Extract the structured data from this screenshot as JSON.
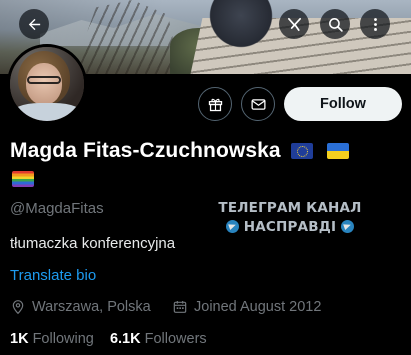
{
  "header": {
    "back_icon": "arrow-left-icon",
    "grok_icon": "grok-icon",
    "search_icon": "search-icon",
    "more_icon": "more-vertical-icon"
  },
  "profile": {
    "display_name": "Magda Fitas-Czuchnowska",
    "flags": [
      "eu-flag",
      "ukraine-flag",
      "rainbow-flag"
    ],
    "handle": "@MagdaFitas",
    "bio": "tłumaczka konferencyjna",
    "translate_label": "Translate bio",
    "location": "Warszawa, Polska",
    "joined": "Joined August 2012",
    "following_count": "1K",
    "following_label": "Following",
    "followers_count": "6.1K",
    "followers_label": "Followers"
  },
  "actions": {
    "gift_icon": "gift-icon",
    "message_icon": "envelope-icon",
    "follow_label": "Follow"
  },
  "watermark": {
    "line1": "ТЕЛЕГРАМ КАНАЛ",
    "line2": "НАСПРАВДІ"
  },
  "colors": {
    "background": "#000000",
    "link": "#1d9bf0",
    "muted": "#71767b",
    "follow_bg": "#eff3f4"
  }
}
